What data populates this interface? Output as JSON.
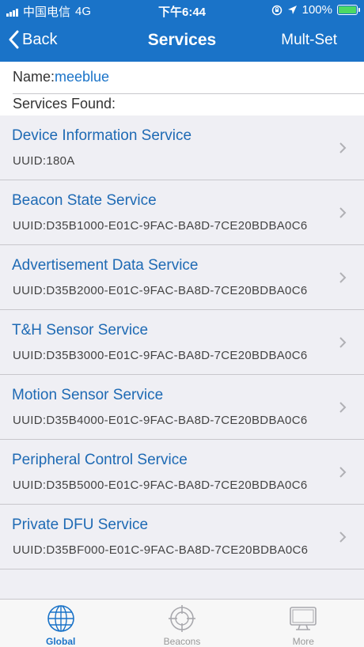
{
  "status_bar": {
    "carrier": "中国电信",
    "network": "4G",
    "time": "下午6:44",
    "battery": "100%",
    "battery_level": 1.0
  },
  "nav": {
    "back_label": "Back",
    "title": "Services",
    "action_label": "Mult-Set"
  },
  "device": {
    "name_label": "Name:",
    "name_value": "meeblue",
    "services_found_label": "Services Found:"
  },
  "services": [
    {
      "title": "Device Information Service",
      "uuid_label": "UUID:",
      "uuid": "180A"
    },
    {
      "title": "Beacon State Service",
      "uuid_label": "UUID:",
      "uuid": "D35B1000-E01C-9FAC-BA8D-7CE20BDBA0C6"
    },
    {
      "title": "Advertisement Data Service",
      "uuid_label": "UUID:",
      "uuid": "D35B2000-E01C-9FAC-BA8D-7CE20BDBA0C6"
    },
    {
      "title": "T&H Sensor Service",
      "uuid_label": "UUID:",
      "uuid": "D35B3000-E01C-9FAC-BA8D-7CE20BDBA0C6"
    },
    {
      "title": "Motion Sensor Service",
      "uuid_label": "UUID:",
      "uuid": "D35B4000-E01C-9FAC-BA8D-7CE20BDBA0C6"
    },
    {
      "title": "Peripheral Control Service",
      "uuid_label": "UUID:",
      "uuid": "D35B5000-E01C-9FAC-BA8D-7CE20BDBA0C6"
    },
    {
      "title": "Private DFU Service",
      "uuid_label": "UUID:",
      "uuid": "D35BF000-E01C-9FAC-BA8D-7CE20BDBA0C6"
    }
  ],
  "tabs": [
    {
      "label": "Global",
      "icon": "globe-icon",
      "active": true
    },
    {
      "label": "Beacons",
      "icon": "crosshair-icon",
      "active": false
    },
    {
      "label": "More",
      "icon": "monitor-icon",
      "active": false
    }
  ],
  "colors": {
    "accent": "#1a73c8",
    "service_title": "#1e6ab4",
    "background": "#efeff4",
    "battery_fill": "#4cd964"
  }
}
